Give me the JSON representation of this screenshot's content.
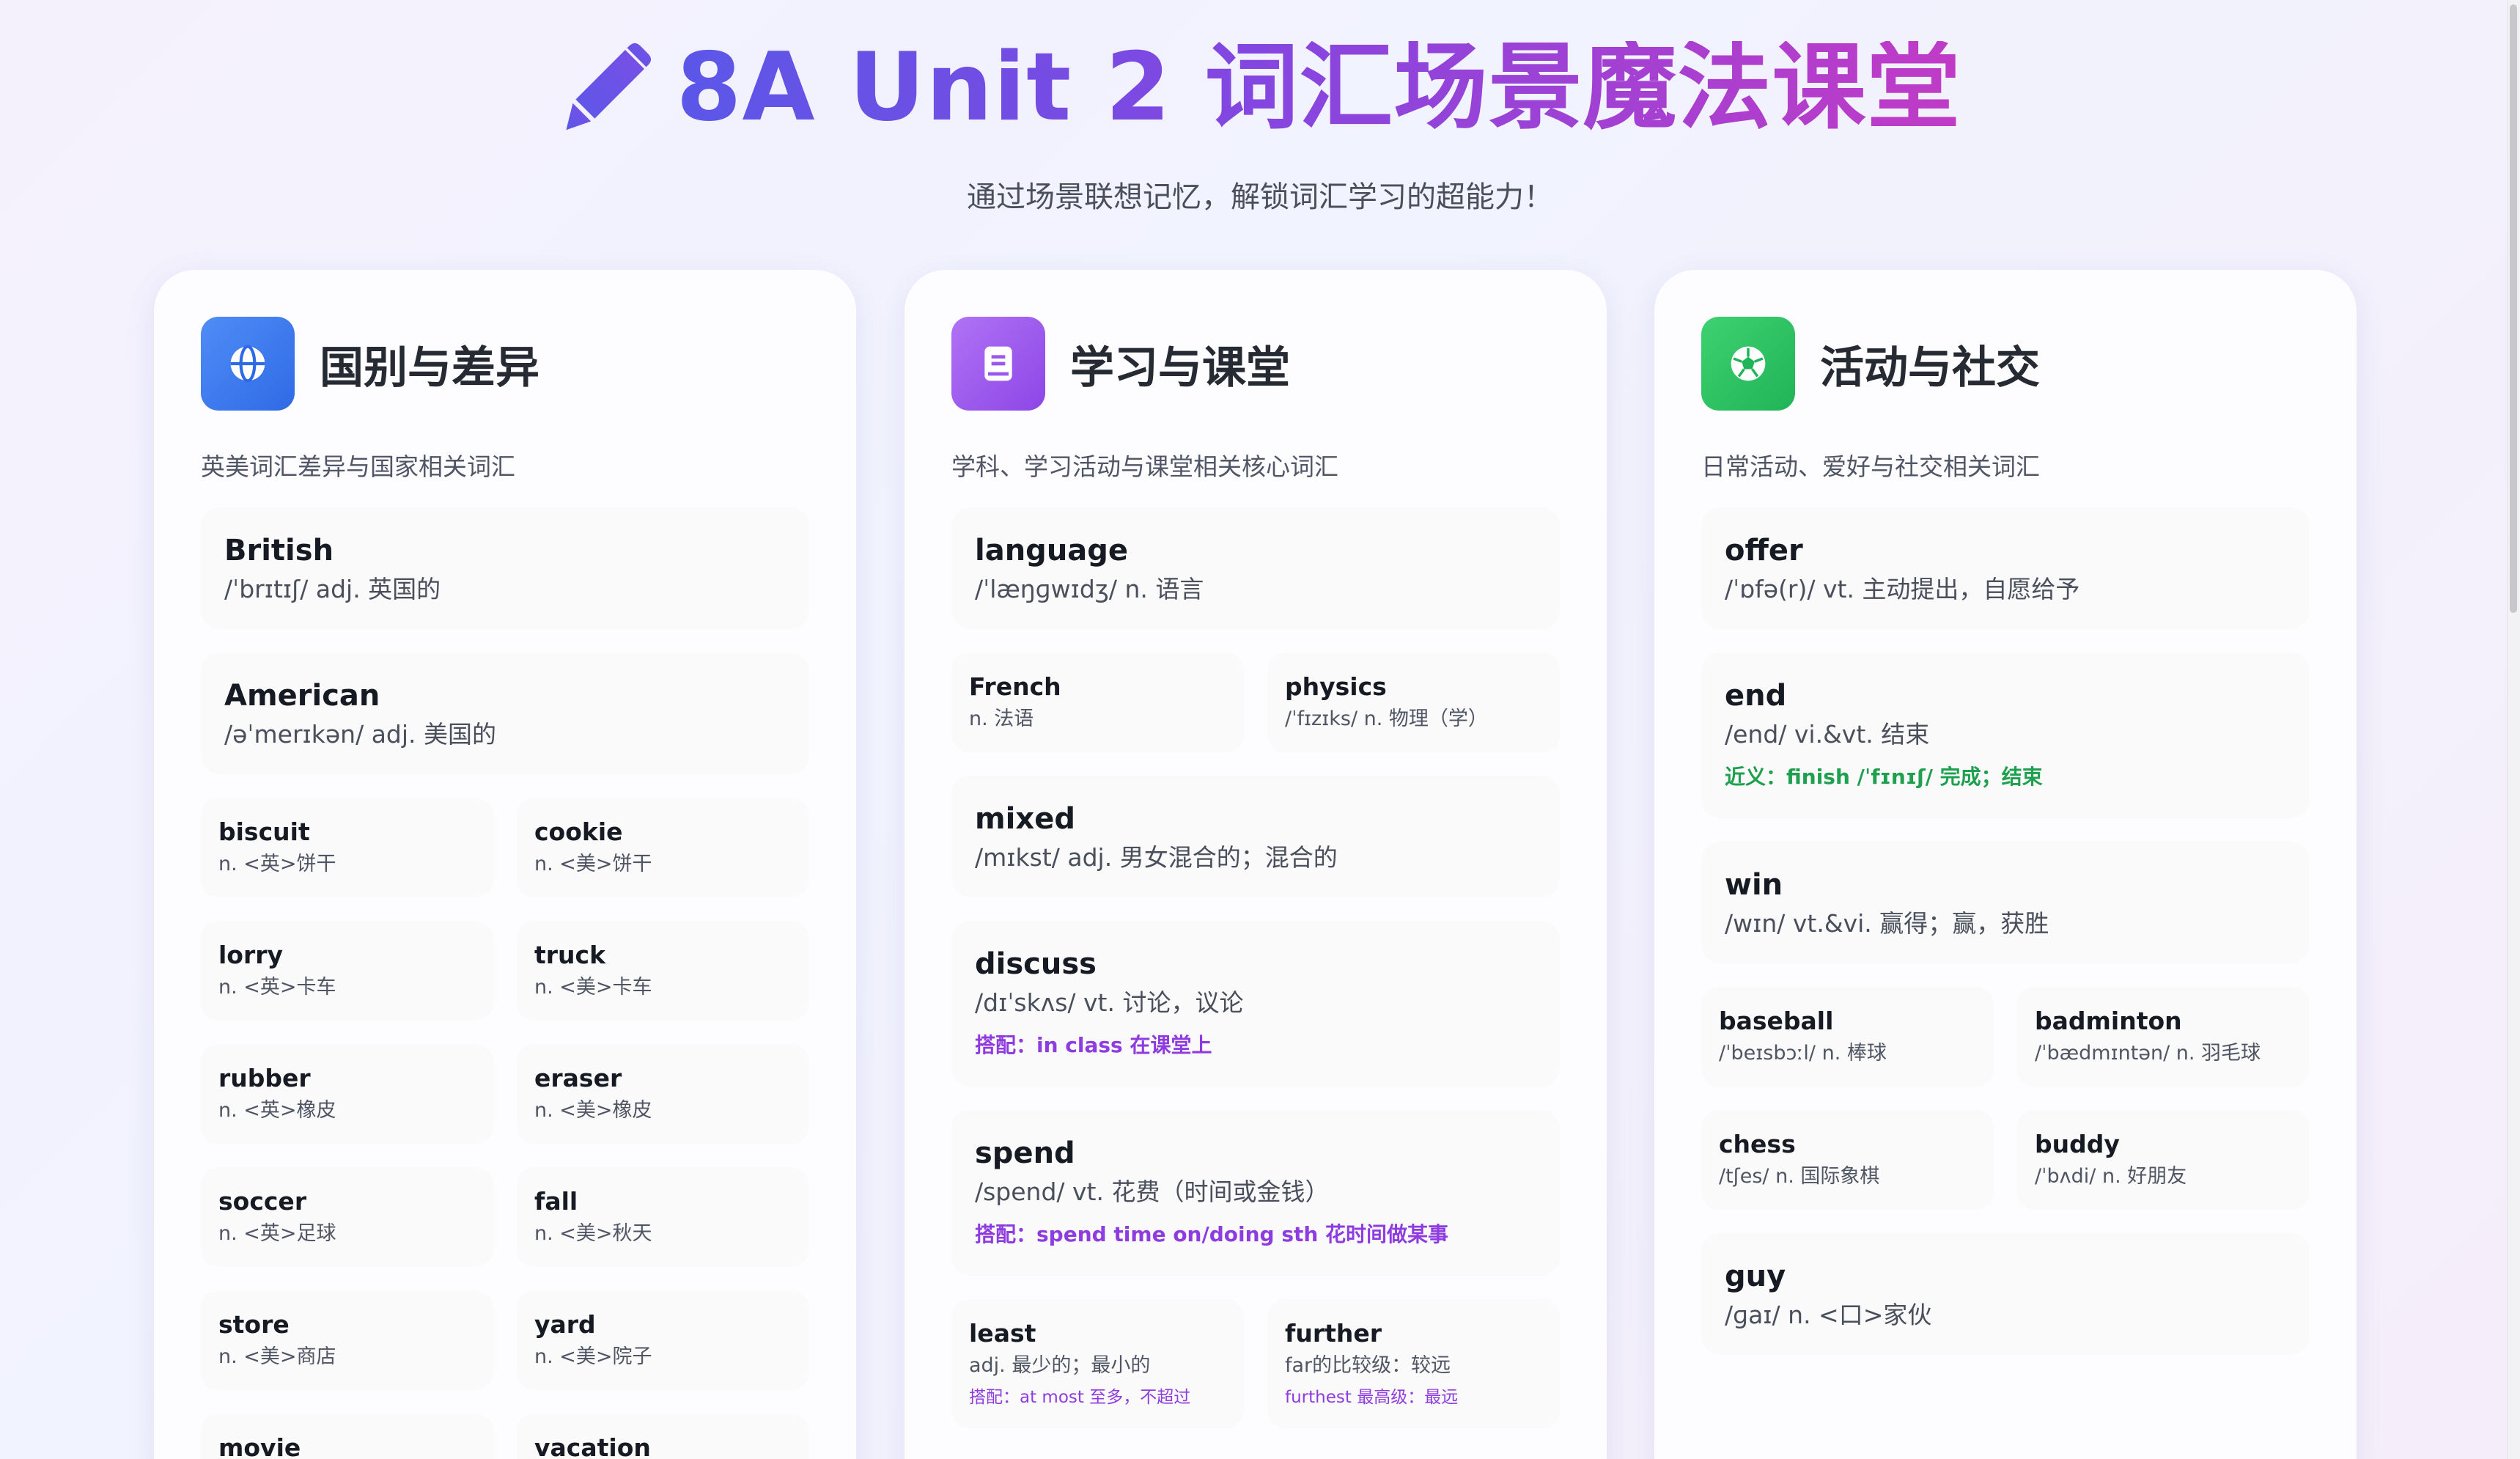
{
  "header": {
    "title": "8A Unit 2 词汇场景魔法课堂",
    "subtitle": "通过场景联想记忆，解锁词汇学习的超能力！",
    "icon": "pencil-icon"
  },
  "colors": {
    "title_gradient": [
      "#5b57e8",
      "#8446e0",
      "#c03bc6"
    ],
    "col1_icon": "#3b7bf0",
    "col2_icon": "#9a57ec",
    "col3_icon": "#29c161",
    "note_purple": "#8e3ce0",
    "note_green": "#1ea04f"
  },
  "columns": [
    {
      "title": "国别与差异",
      "icon": "globe-icon",
      "desc": "英美词汇差异与国家相关词汇",
      "full": [
        {
          "word": "British",
          "def": "/ˈbrɪtɪʃ/ adj. 英国的"
        },
        {
          "word": "American",
          "def": "/əˈmerɪkən/ adj. 美国的"
        }
      ],
      "pairs": [
        [
          {
            "word": "biscuit",
            "def": "n. <英>饼干"
          },
          {
            "word": "cookie",
            "def": "n. <美>饼干"
          }
        ],
        [
          {
            "word": "lorry",
            "def": "n. <英>卡车"
          },
          {
            "word": "truck",
            "def": "n. <美>卡车"
          }
        ],
        [
          {
            "word": "rubber",
            "def": "n. <英>橡皮"
          },
          {
            "word": "eraser",
            "def": "n. <美>橡皮"
          }
        ],
        [
          {
            "word": "soccer",
            "def": "n. <英>足球"
          },
          {
            "word": "fall",
            "def": "n. <美>秋天"
          }
        ],
        [
          {
            "word": "store",
            "def": "n. <美>商店"
          },
          {
            "word": "yard",
            "def": "n. <美>院子"
          }
        ],
        [
          {
            "word": "movie",
            "def": ""
          },
          {
            "word": "vacation",
            "def": ""
          }
        ]
      ]
    },
    {
      "title": "学习与课堂",
      "icon": "book-icon",
      "desc": "学科、学习活动与课堂相关核心词汇",
      "language": {
        "word": "language",
        "def": "/ˈlæŋɡwɪdʒ/ n. 语言"
      },
      "pair1": [
        {
          "word": "French",
          "def": "n. 法语"
        },
        {
          "word": "physics",
          "def": "/ˈfɪzɪks/ n. 物理（学）"
        }
      ],
      "mixed": {
        "word": "mixed",
        "def": "/mɪkst/ adj. 男女混合的；混合的"
      },
      "discuss": {
        "word": "discuss",
        "def": "/dɪˈskʌs/ vt. 讨论，议论",
        "note": "搭配：in class 在课堂上"
      },
      "spend": {
        "word": "spend",
        "def": "/spend/ vt. 花费（时间或金钱）",
        "note": "搭配：spend time on/doing sth 花时间做某事"
      },
      "pair2": [
        {
          "word": "least",
          "def": "adj. 最少的；最小的",
          "note": "搭配：at most 至多，不超过"
        },
        {
          "word": "further",
          "def": "far的比较级：较远",
          "note": "furthest 最高级：最远"
        }
      ]
    },
    {
      "title": "活动与社交",
      "icon": "soccer-ball-icon",
      "desc": "日常活动、爱好与社交相关词汇",
      "offer": {
        "word": "offer",
        "def": "/ˈɒfə(r)/ vt. 主动提出，自愿给予"
      },
      "end": {
        "word": "end",
        "def": "/end/ vi.&vt. 结束",
        "note": "近义：finish /ˈfɪnɪʃ/ 完成；结束"
      },
      "win": {
        "word": "win",
        "def": "/wɪn/ vt.&vi. 赢得；赢，获胜"
      },
      "pair1": [
        {
          "word": "baseball",
          "def": "/ˈbeɪsbɔːl/ n. 棒球"
        },
        {
          "word": "badminton",
          "def": "/ˈbædmɪntən/ n. 羽毛球"
        }
      ],
      "pair2": [
        {
          "word": "chess",
          "def": "/tʃes/ n. 国际象棋"
        },
        {
          "word": "buddy",
          "def": "/ˈbʌdi/ n. 好朋友"
        }
      ],
      "guy": {
        "word": "guy",
        "def": "/ɡaɪ/ n. <口>家伙"
      }
    }
  ]
}
